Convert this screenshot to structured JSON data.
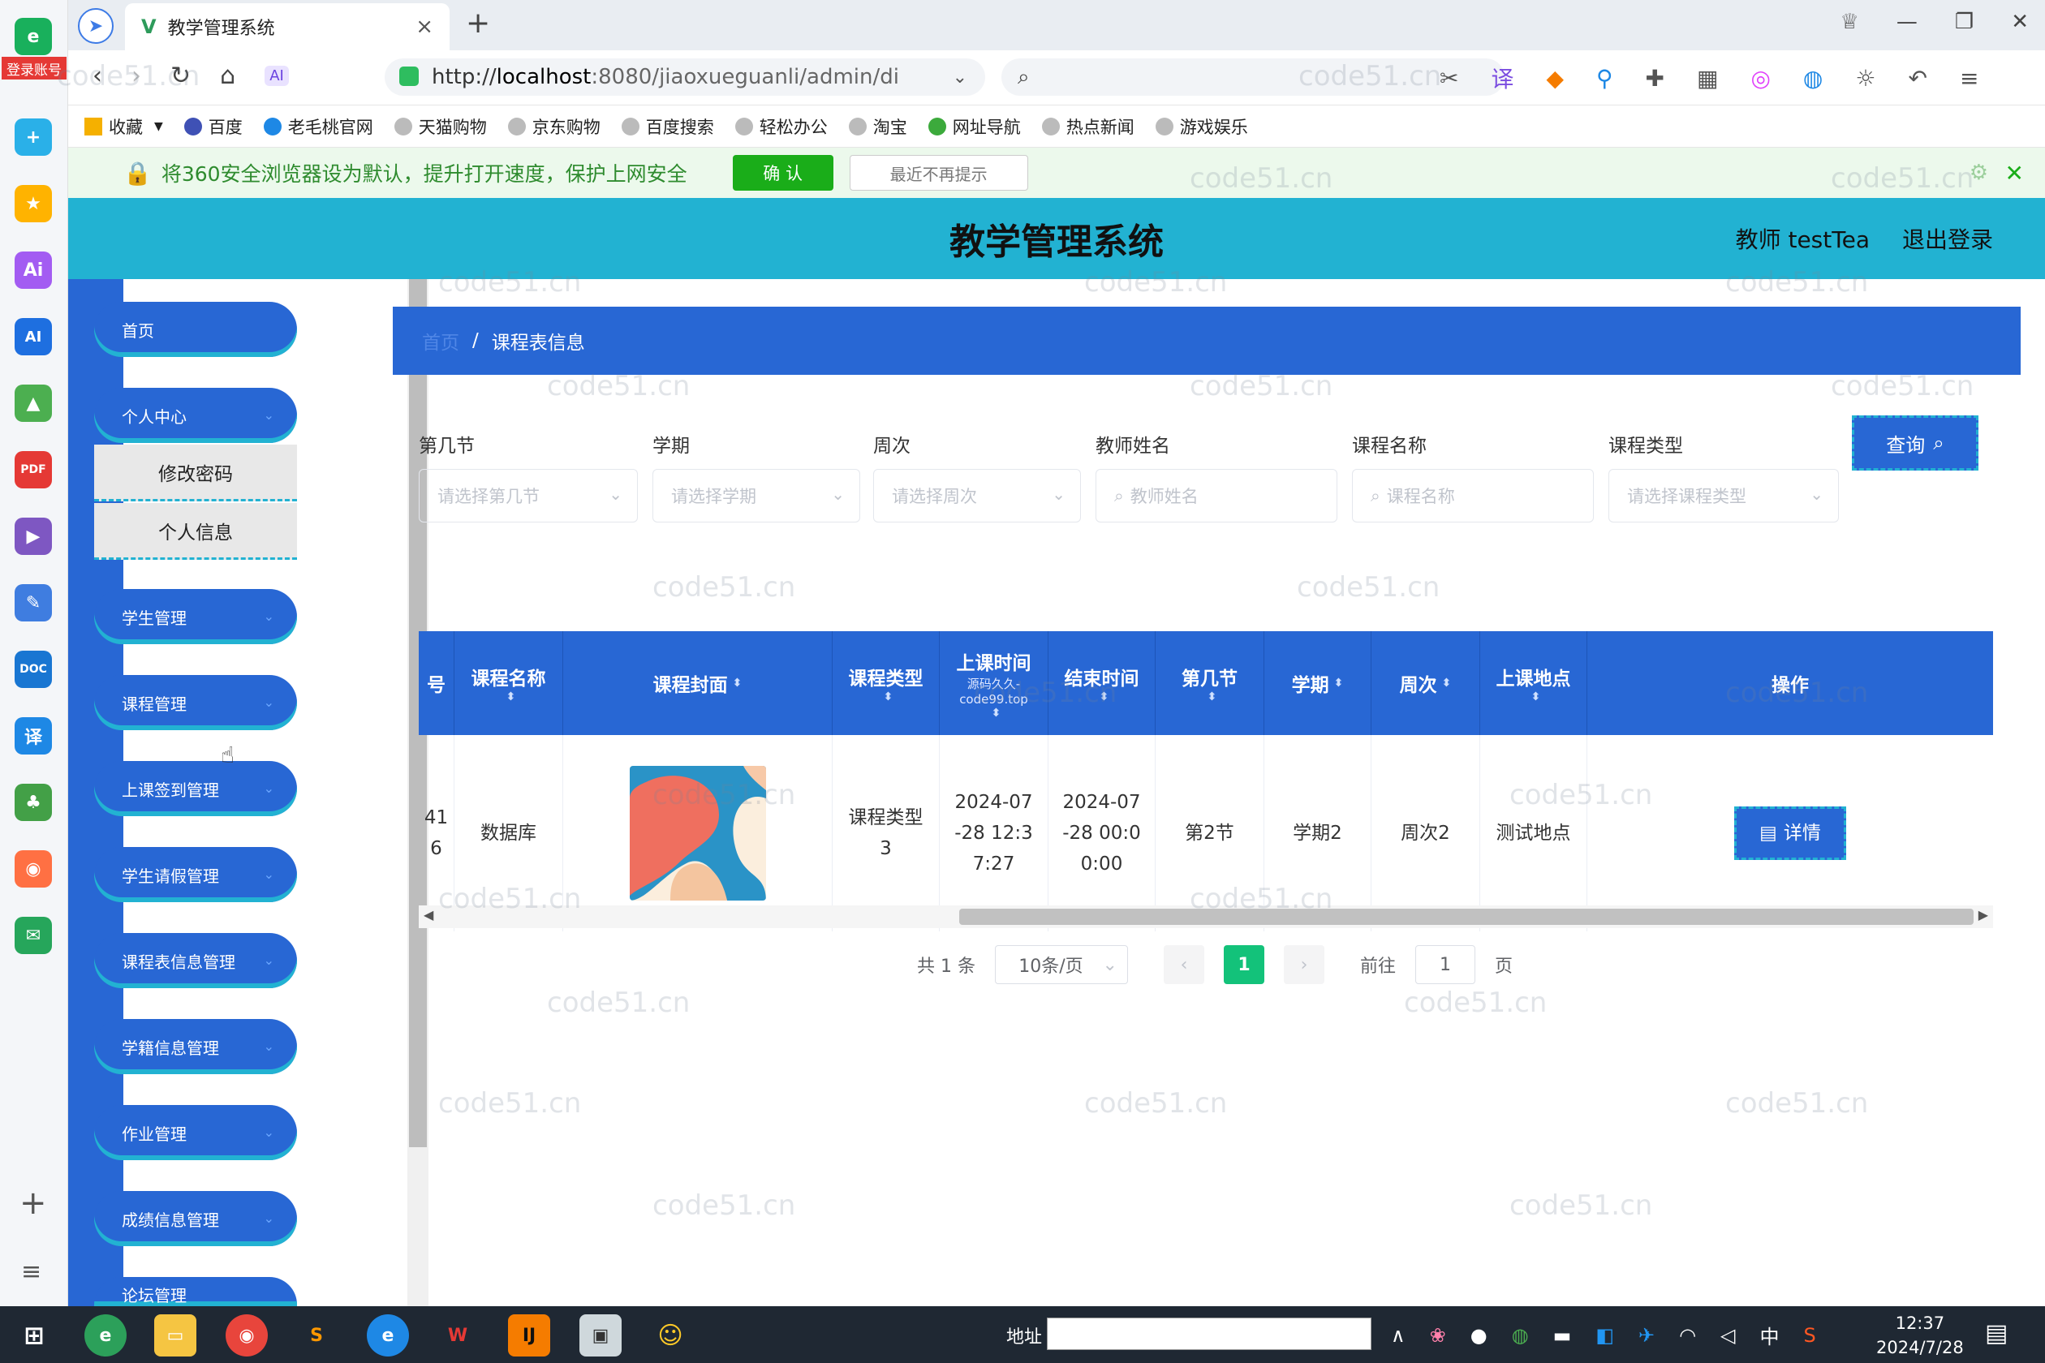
{
  "browser": {
    "tab_title": "教学管理系统",
    "url_prefix": "http://",
    "url_host": "localhost",
    "url_rest": ":8080/jiaoxueguanli/admin/di",
    "search_placeholder": "",
    "login_badge": "登录账号",
    "bookmarks": [
      "收藏",
      "百度",
      "老毛桃官网",
      "天猫购物",
      "京东购物",
      "百度搜索",
      "轻松办公",
      "淘宝",
      "网址导航",
      "热点新闻",
      "游戏娱乐"
    ],
    "notice_text": "将360安全浏览器设为默认，提升打开速度，保护上网安全",
    "notice_confirm": "确 认",
    "notice_later": "最近不再提示"
  },
  "app": {
    "title": "教学管理系统",
    "user": "教师 testTea",
    "logout": "退出登录"
  },
  "sidebar": {
    "menus": [
      "首页",
      "个人中心",
      "学生管理",
      "课程管理",
      "上课签到管理",
      "学生请假管理",
      "课程表信息管理",
      "学籍信息管理",
      "作业管理",
      "成绩信息管理",
      "论坛管理"
    ],
    "submenus": [
      "修改密码",
      "个人信息"
    ]
  },
  "breadcrumb": {
    "home": "首页",
    "sep": "/",
    "current": "课程表信息"
  },
  "filters": {
    "labels": [
      "第几节",
      "学期",
      "周次",
      "教师姓名",
      "课程名称",
      "课程类型"
    ],
    "placeholders": [
      "请选择第几节",
      "请选择学期",
      "请选择周次",
      "教师姓名",
      "课程名称",
      "请选择课程类型"
    ],
    "query": "查询"
  },
  "table": {
    "headers": [
      "号",
      "课程名称",
      "课程封面",
      "课程类型",
      "上课时间",
      "结束时间",
      "第几节",
      "学期",
      "周次",
      "上课地点",
      "操作"
    ],
    "header_note": "源码久久-code99.top",
    "row": {
      "no": "41\n6",
      "course_name": "数据库",
      "course_type": "课程类型\n3",
      "start": "2024-07\n-28 12:3\n7:27",
      "end": "2024-07\n-28 00:0\n0:00",
      "section": "第2节",
      "term": "学期2",
      "week": "周次2",
      "location": "测试地点",
      "action": "详情"
    }
  },
  "pager": {
    "total": "共 1 条",
    "page_size": "10条/页",
    "current": "1",
    "goto": "前往",
    "goto_value": "1",
    "page_unit": "页"
  },
  "taskbar": {
    "address_label": "地址",
    "ime": "中",
    "time": "12:37",
    "date": "2024/7/28"
  },
  "watermark": "code51.cn",
  "colors": {
    "header": "#22b2d2",
    "primary": "#2867d4",
    "active_page": "#13c27a"
  }
}
